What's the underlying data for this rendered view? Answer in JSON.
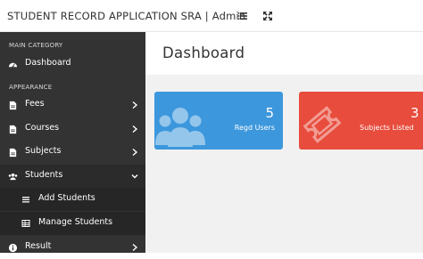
{
  "app": {
    "title": "STUDENT RECORD APPLICATION SRA | Admin"
  },
  "topbar": {
    "icons": [
      "list-toggle-icon",
      "fullscreen-icon"
    ]
  },
  "sidebar": {
    "sections": [
      "MAIN CATEGORY",
      "APPEARANCE"
    ],
    "items": [
      {
        "label": "Dashboard",
        "icon": "dashboard-icon"
      },
      {
        "label": "Fees",
        "icon": "file-icon"
      },
      {
        "label": "Courses",
        "icon": "file-icon"
      },
      {
        "label": "Subjects",
        "icon": "file-icon"
      },
      {
        "label": "Students",
        "icon": "users-icon",
        "expanded": true,
        "children": [
          {
            "label": "Add Students",
            "icon": "list-icon"
          },
          {
            "label": "Manage Students",
            "icon": "table-icon"
          }
        ]
      },
      {
        "label": "Result",
        "icon": "info-icon"
      }
    ]
  },
  "main": {
    "title": "Dashboard",
    "cards": [
      {
        "value": "5",
        "caption": "Regd Users",
        "color": "#3d97dc",
        "icon": "users-icon"
      },
      {
        "value": "3",
        "caption": "Subjects Listed",
        "color": "#e74c3c",
        "icon": "ticket-icon"
      }
    ]
  },
  "colors": {
    "sidebar": "#333333",
    "content_bg": "#f1f1f1",
    "card_blue": "#3d97dc",
    "card_red": "#e74c3c"
  }
}
